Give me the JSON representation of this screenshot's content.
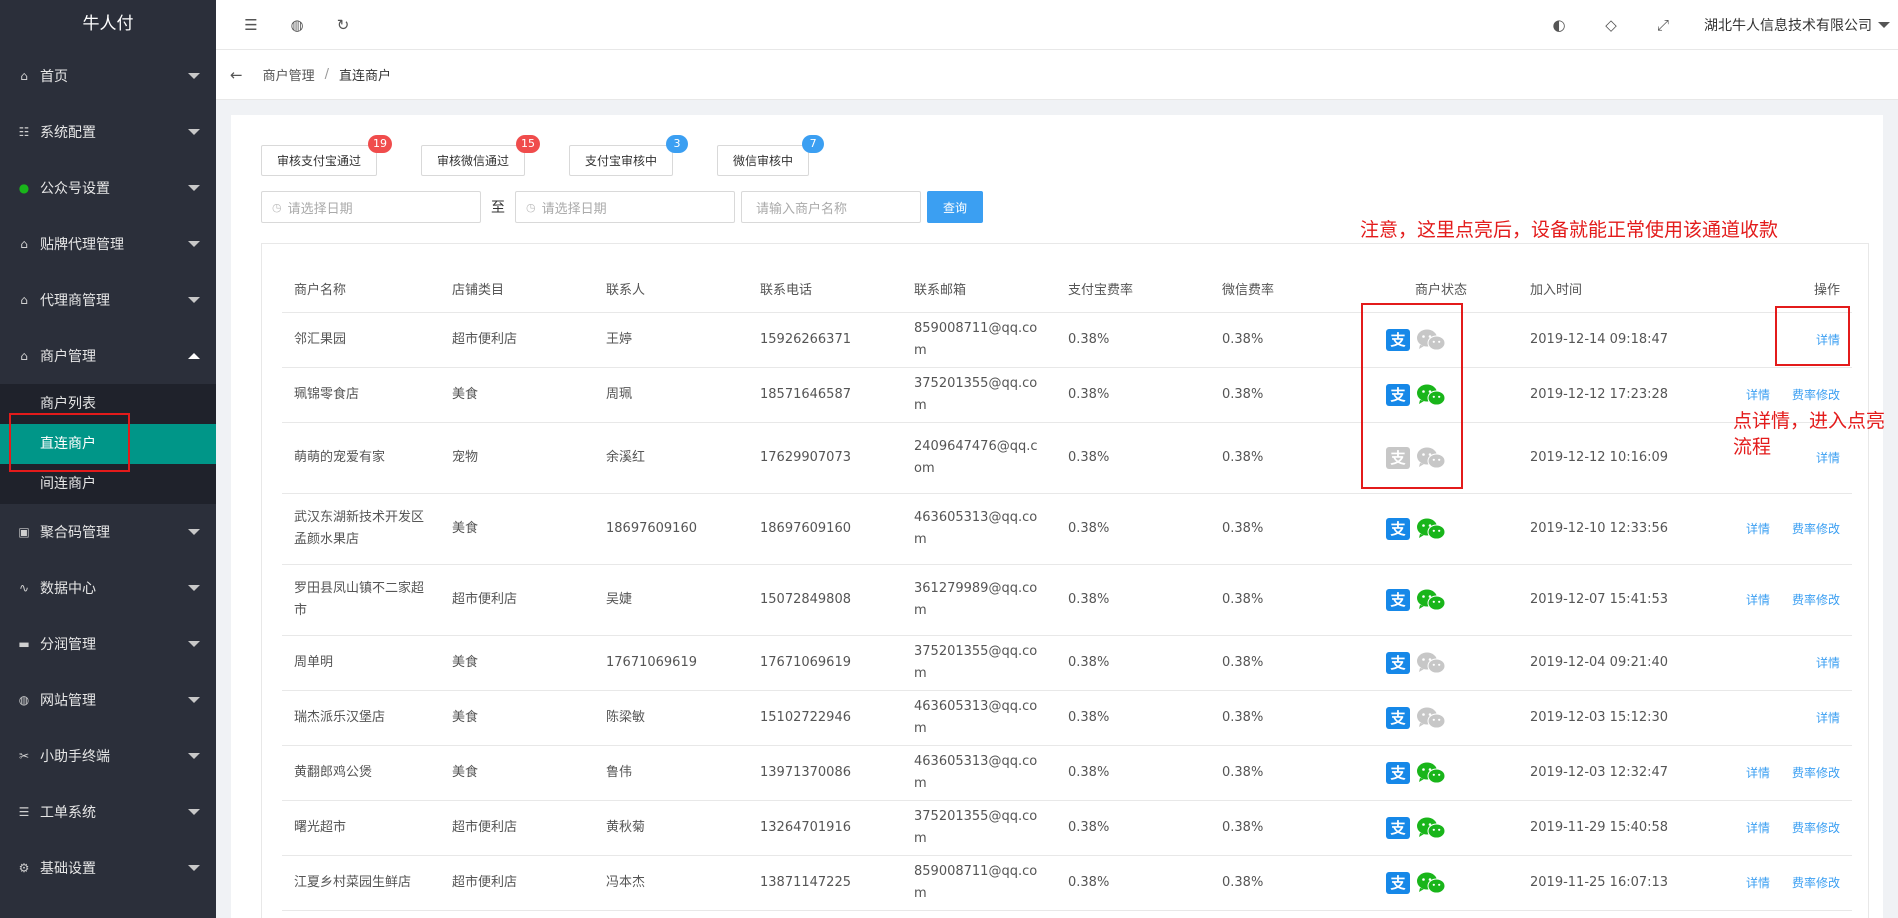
{
  "app": {
    "logo": "牛人付"
  },
  "sidebar": {
    "items": [
      {
        "label": "首页",
        "icon": "home-icon",
        "glyph": "⌂"
      },
      {
        "label": "系统配置",
        "icon": "config-icon",
        "glyph": "☷"
      },
      {
        "label": "公众号设置",
        "icon": "wechat-icon",
        "glyph": "●"
      },
      {
        "label": "贴牌代理管理",
        "icon": "home-icon",
        "glyph": "⌂"
      },
      {
        "label": "代理商管理",
        "icon": "home-icon",
        "glyph": "⌂"
      },
      {
        "label": "商户管理",
        "icon": "home-icon",
        "glyph": "⌂"
      }
    ],
    "submenu": [
      "商户列表",
      "直连商户",
      "间连商户"
    ],
    "items_after": [
      {
        "label": "聚合码管理",
        "icon": "qrcode-icon",
        "glyph": "▣"
      },
      {
        "label": "数据中心",
        "icon": "chart-icon",
        "glyph": "∿"
      },
      {
        "label": "分润管理",
        "icon": "monitor-icon",
        "glyph": "▬"
      },
      {
        "label": "网站管理",
        "icon": "globe-icon",
        "glyph": "◍"
      },
      {
        "label": "小助手终端",
        "icon": "terminal-icon",
        "glyph": "✂"
      },
      {
        "label": "工单系统",
        "icon": "ticket-icon",
        "glyph": "☰"
      },
      {
        "label": "基础设置",
        "icon": "gear-icon",
        "glyph": "⚙"
      }
    ]
  },
  "topbar": {
    "icons": [
      "menu-fold-icon",
      "globe-icon",
      "refresh-icon"
    ],
    "right_icons": [
      "palette-icon",
      "tag-icon",
      "fullscreen-icon"
    ],
    "company": "湖北牛人信息技术有限公司"
  },
  "breadcrumb": {
    "parent": "商户管理",
    "current": "直连商户"
  },
  "filters": {
    "tabs": [
      {
        "label": "审核支付宝通过",
        "count": "19",
        "color": "red"
      },
      {
        "label": "审核微信通过",
        "count": "15",
        "color": "red"
      },
      {
        "label": "支付宝审核中",
        "count": "3",
        "color": "blue"
      },
      {
        "label": "微信审核中",
        "count": "7",
        "color": "blue"
      }
    ],
    "date_placeholder": "请选择日期",
    "to": "至",
    "name_placeholder": "请输入商户名称",
    "query": "查询"
  },
  "table": {
    "headers": [
      "商户名称",
      "店铺类目",
      "联系人",
      "联系电话",
      "联系邮箱",
      "支付宝费率",
      "微信费率",
      "商户状态",
      "加入时间",
      "操作"
    ],
    "rows": [
      {
        "name": "邻汇果园",
        "category": "超市便利店",
        "contact": "王婷",
        "phone": "15926266371",
        "email": "859008711@qq.com",
        "ali_rate": "0.38%",
        "wx_rate": "0.38%",
        "ali": true,
        "wx": false,
        "time": "2019-12-14 09:18:47",
        "ops": [
          "详情"
        ]
      },
      {
        "name": "珮锦零食店",
        "category": "美食",
        "contact": "周珮",
        "phone": "18571646587",
        "email": "375201355@qq.com",
        "ali_rate": "0.38%",
        "wx_rate": "0.38%",
        "ali": true,
        "wx": true,
        "time": "2019-12-12 17:23:28",
        "ops": [
          "详情",
          "费率修改"
        ]
      },
      {
        "name": "萌萌的宠爱有家",
        "category": "宠物",
        "contact": "余溪红",
        "phone": "17629907073",
        "email": "2409647476@qq.com",
        "ali_rate": "0.38%",
        "wx_rate": "0.38%",
        "ali": false,
        "wx": false,
        "time": "2019-12-12 10:16:09",
        "ops": [
          "详情"
        ]
      },
      {
        "name": "武汉东湖新技术开发区孟颜水果店",
        "category": "美食",
        "contact": "18697609160",
        "phone": "18697609160",
        "email": "463605313@qq.com",
        "ali_rate": "0.38%",
        "wx_rate": "0.38%",
        "ali": true,
        "wx": true,
        "time": "2019-12-10 12:33:56",
        "ops": [
          "详情",
          "费率修改"
        ]
      },
      {
        "name": "罗田县凤山镇不二家超市",
        "category": "超市便利店",
        "contact": "吴婕",
        "phone": "15072849808",
        "email": "361279989@qq.com",
        "ali_rate": "0.38%",
        "wx_rate": "0.38%",
        "ali": true,
        "wx": true,
        "time": "2019-12-07 15:41:53",
        "ops": [
          "详情",
          "费率修改"
        ]
      },
      {
        "name": "周单明",
        "category": "美食",
        "contact": "17671069619",
        "phone": "17671069619",
        "email": "375201355@qq.com",
        "ali_rate": "0.38%",
        "wx_rate": "0.38%",
        "ali": true,
        "wx": false,
        "time": "2019-12-04 09:21:40",
        "ops": [
          "详情"
        ]
      },
      {
        "name": "瑞杰派乐汉堡店",
        "category": "美食",
        "contact": "陈梁敏",
        "phone": "15102722946",
        "email": "463605313@qq.com",
        "ali_rate": "0.38%",
        "wx_rate": "0.38%",
        "ali": true,
        "wx": false,
        "time": "2019-12-03 15:12:30",
        "ops": [
          "详情"
        ]
      },
      {
        "name": "黄翻郎鸡公煲",
        "category": "美食",
        "contact": "鲁伟",
        "phone": "13971370086",
        "email": "463605313@qq.com",
        "ali_rate": "0.38%",
        "wx_rate": "0.38%",
        "ali": true,
        "wx": true,
        "time": "2019-12-03 12:32:47",
        "ops": [
          "详情",
          "费率修改"
        ]
      },
      {
        "name": "曙光超市",
        "category": "超市便利店",
        "contact": "黄秋菊",
        "phone": "13264701916",
        "email": "375201355@qq.com",
        "ali_rate": "0.38%",
        "wx_rate": "0.38%",
        "ali": true,
        "wx": true,
        "time": "2019-11-29 15:40:58",
        "ops": [
          "详情",
          "费率修改"
        ]
      },
      {
        "name": "江夏乡村菜园生鲜店",
        "category": "超市便利店",
        "contact": "冯本杰",
        "phone": "13871147225",
        "email": "859008711@qq.com",
        "ali_rate": "0.38%",
        "wx_rate": "0.38%",
        "ali": true,
        "wx": true,
        "time": "2019-11-25 16:07:13",
        "ops": [
          "详情",
          "费率修改"
        ]
      }
    ]
  },
  "annotations": {
    "note1": "注意，这里点亮后，设备就能正常使用该通道收款",
    "note2": "点详情，进入点亮流程"
  },
  "colors": {
    "accent": "#009688",
    "link": "#3b9ff2",
    "alipay": "#1688e8",
    "wechat": "#19b51a",
    "annotation": "#e31b1b"
  }
}
